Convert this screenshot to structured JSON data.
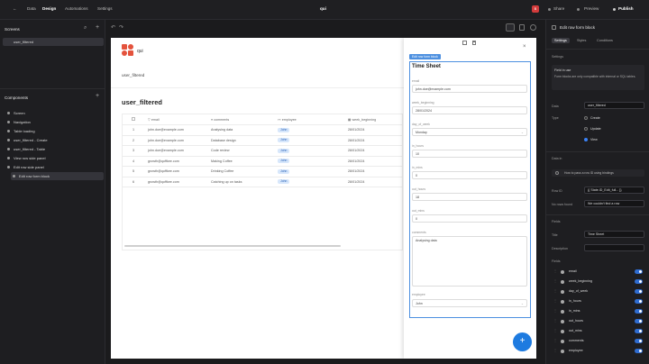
{
  "topbar": {
    "back": "←",
    "tabs": [
      {
        "label": "Data"
      },
      {
        "label": "Design"
      },
      {
        "label": "Automations"
      },
      {
        "label": "Settings"
      }
    ],
    "app_title": "qui",
    "avatar": "B",
    "share": "Share",
    "preview": "Preview",
    "publish": "Publish"
  },
  "left": {
    "screens_title": "Screens",
    "screens": [
      {
        "label": "user_filtered"
      }
    ],
    "components_title": "Components",
    "components": [
      {
        "label": "Screen"
      },
      {
        "label": "Navigation"
      },
      {
        "label": "Table loading"
      },
      {
        "label": "user_filtered - Create"
      },
      {
        "label": "user_filtered - Table"
      },
      {
        "label": "View row side panel"
      },
      {
        "label": "Edit row side panel"
      },
      {
        "label": "Edit row form block"
      }
    ]
  },
  "canvas": {
    "logo_label": "qui",
    "nav_link": "user_filtered",
    "heading": "user_filtered",
    "table": {
      "columns": [
        "email",
        "comments",
        "employee",
        "week_beginning"
      ],
      "rows": [
        {
          "num": "1",
          "email": "john.doe@example.com",
          "comments": "Analysing data",
          "employee": "John",
          "week": "28/01/2024"
        },
        {
          "num": "2",
          "email": "john.doe@example.com",
          "comments": "Database design",
          "employee": "John",
          "week": "28/01/2024"
        },
        {
          "num": "3",
          "email": "john.doe@example.com",
          "comments": "Code review",
          "employee": "John",
          "week": "28/01/2024"
        },
        {
          "num": "4",
          "email": "growth@qoffkee.com",
          "comments": "Making Coffee",
          "employee": "John",
          "week": "28/01/2024"
        },
        {
          "num": "5",
          "email": "growth@qoffkee.com",
          "comments": "Drinking Coffee",
          "employee": "John",
          "week": "28/01/2024"
        },
        {
          "num": "6",
          "email": "growth@qoffkee.com",
          "comments": "Catching up on tasks",
          "employee": "John",
          "week": "28/01/2024"
        }
      ]
    },
    "side": {
      "close": "×",
      "block_tag": "Edit row form block",
      "title": "Time Sheet",
      "fields": [
        {
          "label": "email",
          "value": "john.doe@example.com"
        },
        {
          "label": "week_beginning",
          "value": "28/01/2024"
        },
        {
          "label": "day_of_week",
          "value": "Monday"
        },
        {
          "label": "in_hours",
          "value": "10"
        },
        {
          "label": "in_mins",
          "value": "0"
        },
        {
          "label": "out_hours",
          "value": "18"
        },
        {
          "label": "out_mins",
          "value": "0"
        },
        {
          "label": "comments",
          "value": "Analysing data"
        },
        {
          "label": "employee",
          "value": "John"
        }
      ],
      "fab": "+"
    }
  },
  "right": {
    "title": "Edit row form block",
    "tabs": [
      "Settings",
      "Styles",
      "Conditions"
    ],
    "section1": "Settings",
    "notice_title": "Field in use",
    "notice_text": "Form blocks are only compatible with internal or SQL tables.",
    "data_label": "Data",
    "data_value": "user_filtered",
    "type_label": "Type",
    "types": [
      "Create",
      "Update",
      "View"
    ],
    "section2": "Data in",
    "link": "How to pass a row ID using bindings",
    "row_id_label": "Row ID",
    "row_id_value": "{{ State.ID_Edit_full... }}",
    "no_rows_label": "No rows found",
    "no_rows_value": "We couldn't find a row",
    "section3": "Fields",
    "title_label": "Title",
    "title_value": "Time Sheet",
    "desc_label": "Description",
    "fields_label": "Fields",
    "field_list": [
      "email",
      "week_beginning",
      "day_of_week",
      "in_hours",
      "in_mins",
      "out_hours",
      "out_mins",
      "comments",
      "employee"
    ]
  }
}
